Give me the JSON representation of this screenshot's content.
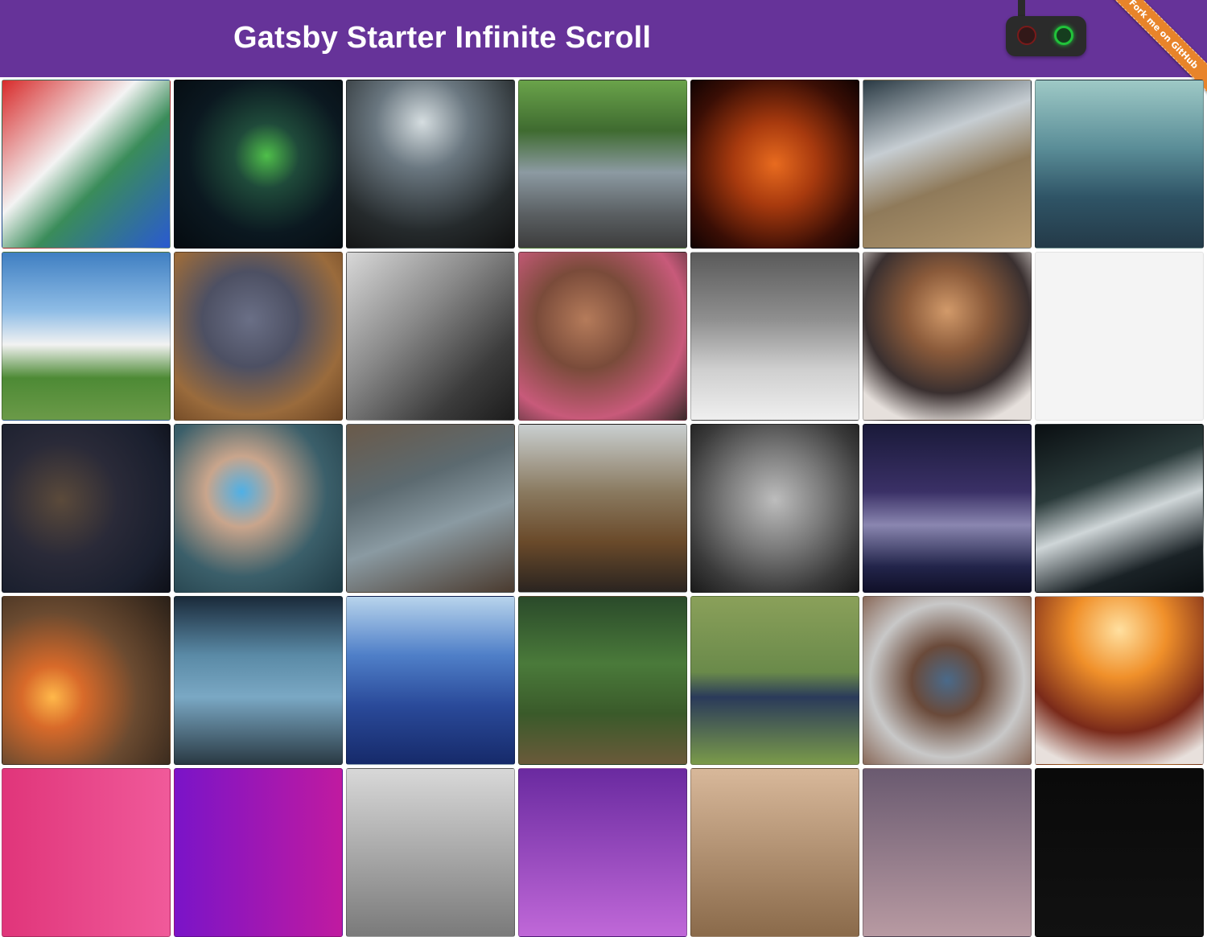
{
  "header": {
    "title": "Gatsby Starter Infinite Scroll",
    "background": "#663399"
  },
  "theme_toggle": {
    "icon": "traffic-light-toggle-icon",
    "state": "green-on"
  },
  "ribbon": {
    "text": "Fork me on GitHub",
    "color": "#e8842a"
  },
  "gallery": {
    "tiles": [
      {
        "name": "woman-striped-sweater-photo",
        "bg": "linear-gradient(135deg,#d82b2b 0%,#f3f3f3 40%,#3a8c5a 60%,#2a5ad1 100%)"
      },
      {
        "name": "northern-lights-photo",
        "bg": "radial-gradient(ellipse at 55% 45%,#4fbf4a 0%,#1f4a3a 25%,#0b1820 60%,#050b10 100%)"
      },
      {
        "name": "dry-plant-silhouette-photo",
        "bg": "radial-gradient(circle at 45% 25%,#d5dde0 0%,#6a7780 30%,#252a2c 70%,#111 100%)"
      },
      {
        "name": "vintage-car-photo",
        "bg": "linear-gradient(180deg,#6aa34a 0%,#3f6b30 30%,#8c9aa2 55%,#5a5f62 80%,#3d3d3d 100%)"
      },
      {
        "name": "fire-flames-photo",
        "bg": "radial-gradient(ellipse at 50% 50%,#e86b1f 0%,#a83a0e 35%,#3a0e05 75%,#120302 100%)"
      },
      {
        "name": "person-silver-hoodie-photo",
        "bg": "linear-gradient(160deg,#2a3a44 0%,#c6cdd2 35%,#8f7a5a 60%,#b59a70 100%)"
      },
      {
        "name": "mountain-valley-photo",
        "bg": "linear-gradient(180deg,#9ec9c6 0%,#5b8e98 40%,#2f5466 70%,#243a48 100%)"
      },
      {
        "name": "white-house-field-photo",
        "bg": "linear-gradient(180deg,#3f7fc2 0%,#8fbde6 35%,#f2f2f2 55%,#4d8a35 75%,#6b9a48 100%)"
      },
      {
        "name": "hand-with-battery-photo",
        "bg": "radial-gradient(circle at 45% 40%,#6a6f86 0%,#4d5063 35%,#9a6b3c 70%,#6a4322 100%)"
      },
      {
        "name": "holding-hands-bw-photo",
        "bg": "linear-gradient(135deg,#d8d8d8 0%,#8a8a8a 40%,#3c3c3c 75%,#1c1c1c 100%)"
      },
      {
        "name": "flower-crown-photo",
        "bg": "radial-gradient(circle at 40% 40%,#b57b5a 0%,#7a4b3a 35%,#c85a7a 70%,#3a2a2a 100%)"
      },
      {
        "name": "snowy-bicycles-photo",
        "bg": "linear-gradient(180deg,#5a5a5a 0%,#8f8f8f 40%,#cfcfcf 70%,#efefef 100%)"
      },
      {
        "name": "woman-laptop-bed-photo",
        "bg": "radial-gradient(circle at 50% 35%,#d29a6a 0%,#8a5a3a 30%,#3a3030 60%,#e6e0dc 85%)"
      },
      {
        "name": "placeholder-tile",
        "empty": true
      },
      {
        "name": "guitarist-photo",
        "bg": "radial-gradient(circle at 35% 45%,#5b4a3a 0%,#2a2a38 40%,#1a1f2e 75%,#0e1018 100%)"
      },
      {
        "name": "smartwatch-wrist-photo",
        "bg": "radial-gradient(circle at 40% 40%,#4fb0e6 0%,#c9a58c 25%,#3b5f6a 60%,#1f3a44 100%)"
      },
      {
        "name": "old-buildings-sky-photo",
        "bg": "linear-gradient(160deg,#6a5a4a 0%,#5c6a70 35%,#8a9aa2 60%,#4a3a2e 100%)"
      },
      {
        "name": "autumn-forest-road-photo",
        "bg": "linear-gradient(180deg,#c9cfd0 0%,#8a7a60 40%,#6a4a2a 70%,#2a2420 100%)"
      },
      {
        "name": "baby-feet-bw-photo",
        "bg": "radial-gradient(circle at 50% 45%,#bdbdbd 0%,#7a7a7a 40%,#3a3a3a 75%,#1a1a1a 100%)"
      },
      {
        "name": "starry-mountain-night-photo",
        "bg": "linear-gradient(180deg,#1a1a3a 0%,#3a3066 40%,#8a86b0 60%,#22244a 85%,#101028 100%)"
      },
      {
        "name": "city-traffic-night-photo",
        "bg": "linear-gradient(160deg,#0a0f12 0%,#2a3a3a 35%,#cfd6d8 55%,#1a2226 80%,#0a0f12 100%)"
      },
      {
        "name": "campfire-child-photo",
        "bg": "radial-gradient(circle at 30% 60%,#ffb84a 0%,#d86a2a 20%,#6a4a30 55%,#2a2018 100%)"
      },
      {
        "name": "misty-blue-cliff-photo",
        "bg": "linear-gradient(180deg,#1a2a3a 0%,#5a8aa6 35%,#7aa8c4 60%,#2a3a44 100%)"
      },
      {
        "name": "blue-mountain-range-photo",
        "bg": "linear-gradient(180deg,#b8d4ec 0%,#4f7fc8 35%,#2a4a9a 65%,#162a6a 100%)"
      },
      {
        "name": "green-forest-log-photo",
        "bg": "linear-gradient(180deg,#2a4a2a 0%,#4a7a3a 40%,#3a5a2a 70%,#6a5a3a 100%)"
      },
      {
        "name": "woman-chair-grass-photo",
        "bg": "linear-gradient(180deg,#8aa05a 0%,#6a8a4a 45%,#2a3a5a 60%,#7a9a4a 100%)"
      },
      {
        "name": "smiling-couple-photo",
        "bg": "radial-gradient(circle at 50% 50%,#4a6a8a 0%,#6a4a3a 30%,#c8c8c8 65%,#8a6a5a 100%)"
      },
      {
        "name": "wine-glasses-sunset-photo",
        "bg": "radial-gradient(circle at 50% 20%,#ffe0a0 0%,#f0902a 30%,#7a2a1a 65%,#e8e0dc 90%)"
      },
      {
        "name": "pink-gradient-photo",
        "bg": "linear-gradient(90deg,#e0357a 0%,#f05a9a 100%)"
      },
      {
        "name": "purple-gradient-photo",
        "bg": "linear-gradient(90deg,#7a14c8 0%,#c01aa0 100%)"
      },
      {
        "name": "industrial-plant-photo",
        "bg": "linear-gradient(180deg,#d8d8d8 0%,#7a7a7a 100%)"
      },
      {
        "name": "concert-lights-photo",
        "bg": "linear-gradient(180deg,#6a2aa0 0%,#c068d8 100%)"
      },
      {
        "name": "bokeh-lights-photo",
        "bg": "linear-gradient(180deg,#d8b89a 0%,#8a6a4a 100%)"
      },
      {
        "name": "dusk-sky-photo",
        "bg": "linear-gradient(180deg,#6a5a70 0%,#b89aa2 100%)"
      },
      {
        "name": "dark-night-photo",
        "bg": "linear-gradient(180deg,#0a0a0a 0%,#111 100%)"
      }
    ]
  }
}
